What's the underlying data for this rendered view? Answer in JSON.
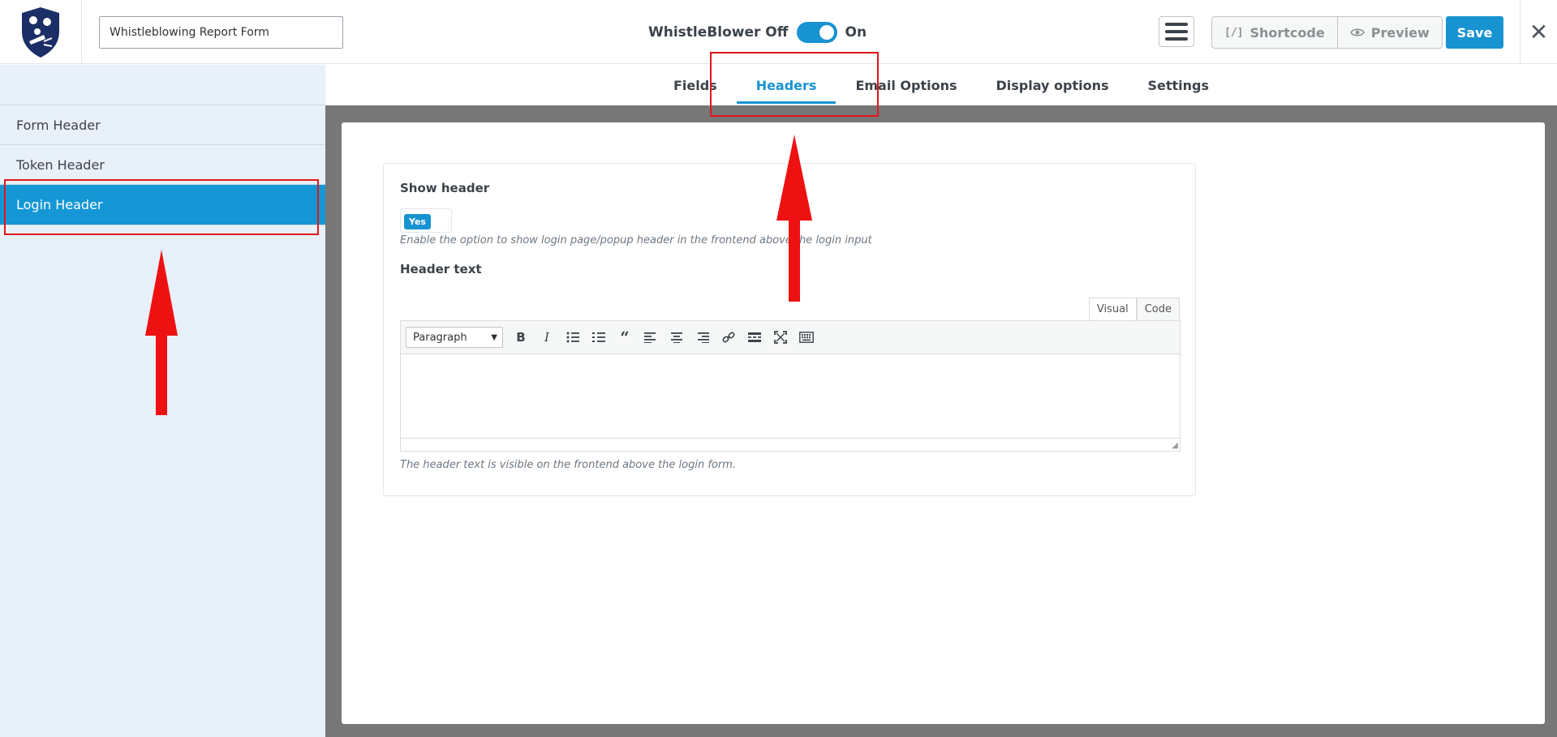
{
  "header": {
    "form_name": "Whistleblowing Report Form",
    "toggle_off_label": "WhistleBlower Off",
    "toggle_on_label": "On",
    "shortcode_label": "Shortcode",
    "preview_label": "Preview",
    "save_label": "Save",
    "close_glyph": "✕"
  },
  "sidebar": {
    "items": [
      {
        "label": "Form Header"
      },
      {
        "label": "Token Header"
      },
      {
        "label": "Login Header"
      }
    ]
  },
  "tabs": [
    {
      "label": "Fields"
    },
    {
      "label": "Headers"
    },
    {
      "label": "Email Options"
    },
    {
      "label": "Display options"
    },
    {
      "label": "Settings"
    }
  ],
  "settings": {
    "show_header_label": "Show header",
    "show_header_value": "Yes",
    "show_header_hint": "Enable the option to show login page/popup header in the frontend above the login input",
    "header_text_label": "Header text",
    "editor_tab_visual": "Visual",
    "editor_tab_code": "Code",
    "format_select": "Paragraph",
    "header_text_hint": "The header text is visible on the frontend above the login form."
  },
  "colors": {
    "accent": "#1793d1",
    "annotation": "#e0161b",
    "sidebar_bg": "#e8f0fa"
  }
}
